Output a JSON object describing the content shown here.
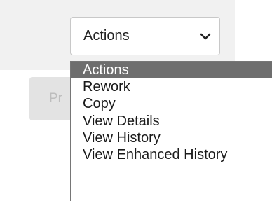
{
  "actions_select": {
    "value": "Actions"
  },
  "background_button": {
    "label": "Pr"
  },
  "dropdown": {
    "options": [
      {
        "label": "Actions",
        "selected": true
      },
      {
        "label": "Rework",
        "selected": false
      },
      {
        "label": "Copy",
        "selected": false
      },
      {
        "label": "View Details",
        "selected": false
      },
      {
        "label": "View History",
        "selected": false
      },
      {
        "label": "View Enhanced History",
        "selected": false
      }
    ]
  },
  "colors": {
    "selected_bg": "#6e6e6e",
    "toolbar_bg": "#f1f1f1"
  },
  "icons": {
    "select_arrow": "chevron-down-icon"
  }
}
